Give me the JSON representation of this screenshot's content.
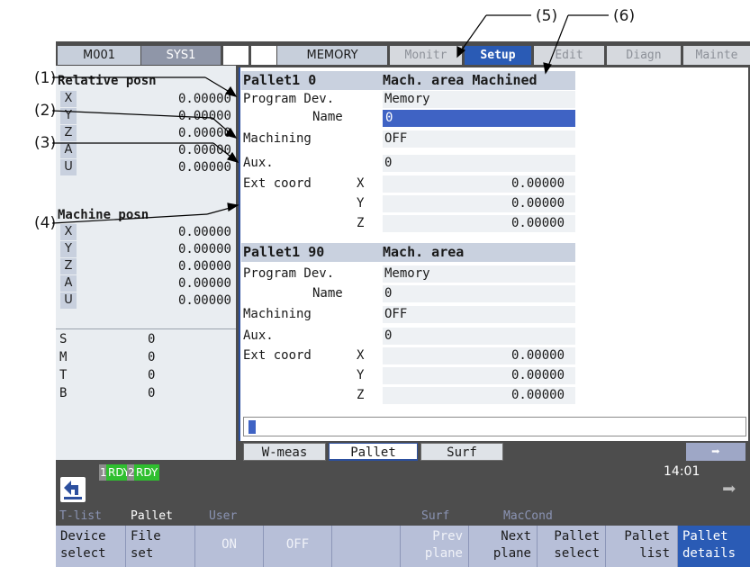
{
  "callouts": {
    "c1": "(1)",
    "c2": "(2)",
    "c3": "(3)",
    "c4": "(4)",
    "c5": "(5)",
    "c6": "(6)"
  },
  "topbar": {
    "m": "M001",
    "sys": "SYS1",
    "mode": "MEMORY",
    "tabs": [
      "Monitr",
      "Setup",
      "Edit",
      "Diagn",
      "Mainte"
    ],
    "active_tab": "Setup"
  },
  "left": {
    "relative_title": "Relative posn",
    "relative": [
      {
        "axis": "X",
        "value": "0.00000"
      },
      {
        "axis": "Y",
        "value": "0.00000"
      },
      {
        "axis": "Z",
        "value": "0.00000"
      },
      {
        "axis": "A",
        "value": "0.00000"
      },
      {
        "axis": "U",
        "value": "0.00000"
      }
    ],
    "machine_title": "Machine posn",
    "machine": [
      {
        "axis": "X",
        "value": "0.00000"
      },
      {
        "axis": "Y",
        "value": "0.00000"
      },
      {
        "axis": "Z",
        "value": "0.00000"
      },
      {
        "axis": "A",
        "value": "0.00000"
      },
      {
        "axis": "U",
        "value": "0.00000"
      }
    ],
    "codes": [
      {
        "axis": "S",
        "value": "0"
      },
      {
        "axis": "M",
        "value": "0"
      },
      {
        "axis": "T",
        "value": "0"
      },
      {
        "axis": "B",
        "value": "0"
      }
    ]
  },
  "pallets": [
    {
      "title": "Pallet1  0",
      "area": "Mach. area Machined",
      "program_dev_label": "Program Dev.",
      "program_dev": "Memory",
      "name_label": "Name",
      "name": "0",
      "machining_label": "Machining",
      "machining": "OFF",
      "aux_label": "Aux.",
      "aux": "0",
      "ext_label": "Ext coord",
      "ext": [
        {
          "axis": "X",
          "value": "0.00000"
        },
        {
          "axis": "Y",
          "value": "0.00000"
        },
        {
          "axis": "Z",
          "value": "0.00000"
        }
      ]
    },
    {
      "title": "Pallet1  90",
      "area": "Mach. area",
      "program_dev_label": "Program Dev.",
      "program_dev": "Memory",
      "name_label": "Name",
      "name": "0",
      "machining_label": "Machining",
      "machining": "OFF",
      "aux_label": "Aux.",
      "aux": "0",
      "ext_label": "Ext coord",
      "ext": [
        {
          "axis": "X",
          "value": "0.00000"
        },
        {
          "axis": "Y",
          "value": "0.00000"
        },
        {
          "axis": "Z",
          "value": "0.00000"
        }
      ]
    }
  ],
  "subtabs": [
    "W-meas",
    "Pallet",
    "Surf"
  ],
  "status": {
    "rdy1_num": "1",
    "rdy1": "RDY",
    "rdy2_num": "2",
    "rdy2": "RDY",
    "time": "14:01"
  },
  "menu_row": [
    "T-list",
    "Pallet",
    "User",
    "",
    "",
    "Surf",
    "MacCond"
  ],
  "softkeys": [
    {
      "l1": "Device",
      "l2": "select"
    },
    {
      "l1": "File",
      "l2": "set"
    },
    {
      "l1": "ON",
      "l2": ""
    },
    {
      "l1": "OFF",
      "l2": ""
    },
    {
      "l1": "",
      "l2": ""
    },
    {
      "l1": "Prev",
      "l2": "plane"
    },
    {
      "l1": "Next",
      "l2": "plane"
    },
    {
      "l1": "Pallet",
      "l2": "select"
    },
    {
      "l1": "Pallet",
      "l2": "list"
    },
    {
      "l1": "Pallet",
      "l2": "details"
    }
  ],
  "colors": {
    "accent": "#2c4f9e",
    "rdy": "#2fbf2f",
    "header": "#c9d1df",
    "softkey": "#b7bfd8"
  }
}
